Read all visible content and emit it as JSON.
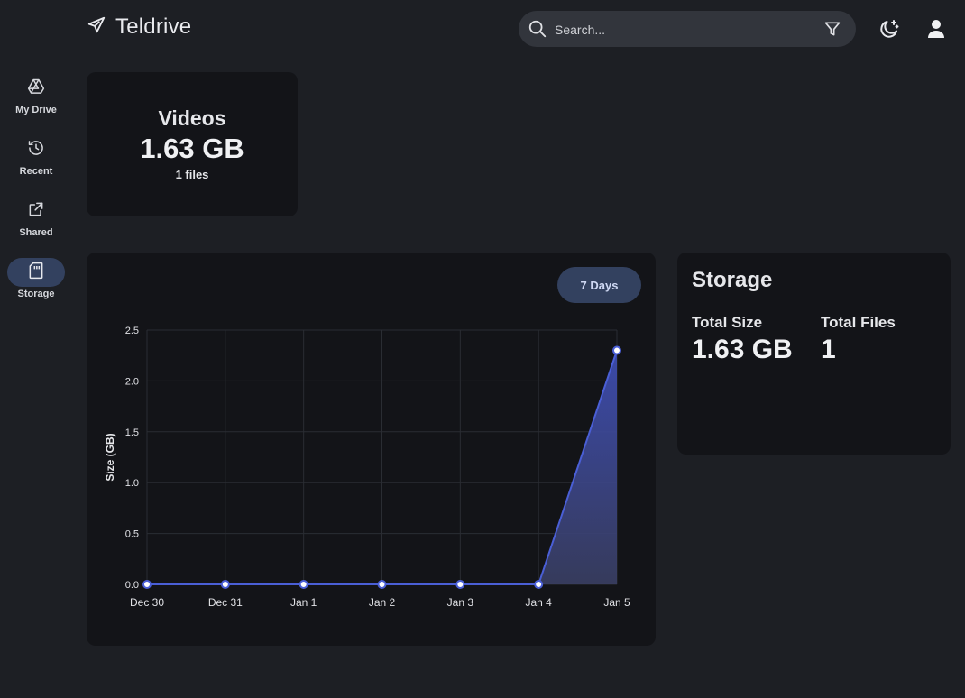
{
  "app": {
    "title": "Teldrive"
  },
  "search": {
    "placeholder": "Search..."
  },
  "sidebar": {
    "items": [
      {
        "label": "My Drive",
        "icon": "google-drive-icon",
        "active": false
      },
      {
        "label": "Recent",
        "icon": "history-icon",
        "active": false
      },
      {
        "label": "Shared",
        "icon": "share-icon",
        "active": false
      },
      {
        "label": "Storage",
        "icon": "sd-card-icon",
        "active": true
      }
    ]
  },
  "category_card": {
    "name": "Videos",
    "size": "1.63 GB",
    "files": "1 files"
  },
  "chart_card": {
    "range_button": "7 Days"
  },
  "storage": {
    "title": "Storage",
    "total_size_label": "Total Size",
    "total_size_value": "1.63 GB",
    "total_files_label": "Total Files",
    "total_files_value": "1"
  },
  "colors": {
    "accent": "#4a5fd6",
    "background": "#1d1f24",
    "card": "#131418",
    "active_pill": "#33415f"
  },
  "chart_data": {
    "type": "area",
    "categories": [
      "Dec 30",
      "Dec 31",
      "Jan 1",
      "Jan 2",
      "Jan 3",
      "Jan 4",
      "Jan 5"
    ],
    "values": [
      0,
      0,
      0,
      0,
      0,
      0,
      2.3
    ],
    "ylabel": "Size (GB)",
    "xlabel": "",
    "ylim": [
      0,
      2.5
    ],
    "yticks": [
      "0.0",
      "0.5",
      "1.0",
      "1.5",
      "2.0",
      "2.5"
    ],
    "ytick_values": [
      0,
      0.5,
      1.0,
      1.5,
      2.0,
      2.5
    ],
    "grid": true,
    "legend": "none"
  }
}
